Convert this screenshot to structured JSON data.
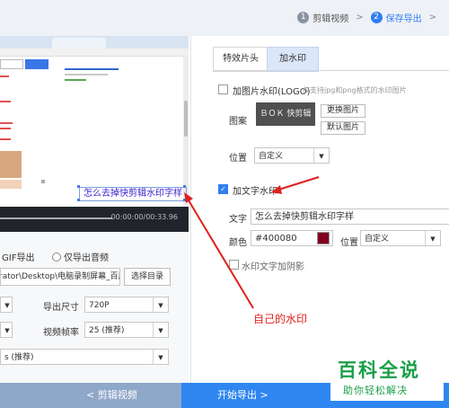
{
  "steps": [
    {
      "num": "1",
      "label": "剪辑视频"
    },
    {
      "num": "2",
      "label": "保存导出"
    }
  ],
  "preview": {
    "watermark_text": "怎么去掉快剪辑水印字样",
    "time": "00:00:00/00:33.96"
  },
  "export": {
    "gif_label": "GIF导出",
    "audio_only_label": "仅导出音频",
    "path": "rator\\Desktop\\电脑录制屏幕_百度",
    "choose_dir": "选择目录",
    "size_label": "导出尺寸",
    "size_value": "720P",
    "framerate_label": "视频帧率",
    "framerate_value": "25 (推荐)",
    "bitrate_value": "s (推荐)"
  },
  "tabs": {
    "effects": "特效片头",
    "watermark": "加水印"
  },
  "image_wm": {
    "label": "加图片水印(LOGO)",
    "hint": "仅支持jpg和png格式的水印图片",
    "pattern_label": "图案",
    "preview_text": "快剪辑",
    "change_btn": "更换图片",
    "default_btn": "默认图片",
    "pos_label": "位置",
    "pos_value": "自定义"
  },
  "text_wm": {
    "label": "加文字水印",
    "text_label": "文字",
    "text_value": "怎么去掉快剪辑水印字样",
    "color_label": "颜色",
    "color_value": "#400080",
    "swatch_color": "#800020",
    "pos_label": "位置",
    "pos_value": "自定义",
    "shadow_label": "水印文字加阴影"
  },
  "bottom": {
    "back": "< 剪辑视频",
    "export": "开始导出 >"
  },
  "annotation": "自己的水印",
  "brand": {
    "top": "百科全说",
    "bottom": "助你轻松解决"
  }
}
